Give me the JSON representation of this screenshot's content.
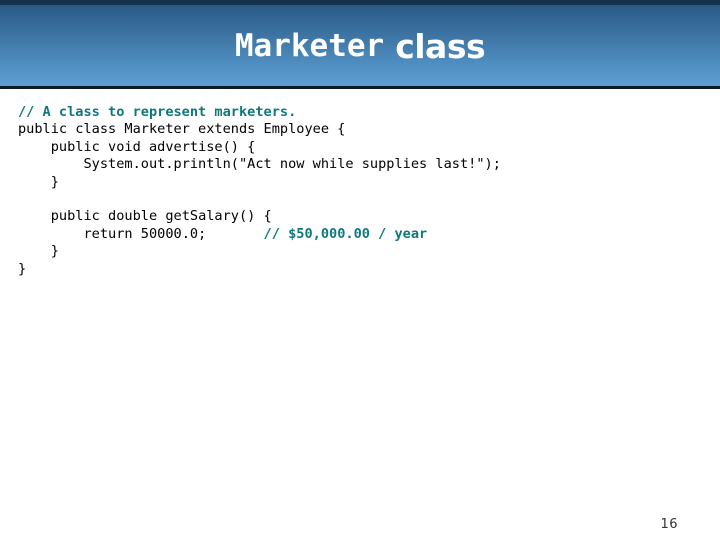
{
  "slide": {
    "title": {
      "mono_part": "Marketer",
      "sans_part": "class"
    },
    "page_number": "16",
    "colors": {
      "header_gradient_top": "#1f4b75",
      "header_gradient_bottom": "#5c9cd0",
      "header_border": "#0d1a28",
      "title_text": "#ffffff",
      "code_text": "#000000",
      "comment_text": "#0f787c",
      "page_number_text": "#333333",
      "background": "#ffffff"
    }
  },
  "code": {
    "language": "java",
    "lines": [
      {
        "indent": "",
        "segments": [
          {
            "kind": "comment",
            "text": "// A class to represent marketers."
          }
        ]
      },
      {
        "indent": "",
        "segments": [
          {
            "kind": "plain",
            "text": "public class Marketer extends Employee {"
          }
        ]
      },
      {
        "indent": "    ",
        "segments": [
          {
            "kind": "plain",
            "text": "public void advertise() {"
          }
        ]
      },
      {
        "indent": "        ",
        "segments": [
          {
            "kind": "plain",
            "text": "System.out.println(\"Act now while supplies last!\");"
          }
        ]
      },
      {
        "indent": "    ",
        "segments": [
          {
            "kind": "plain",
            "text": "}"
          }
        ]
      },
      {
        "indent": "",
        "segments": []
      },
      {
        "indent": "    ",
        "segments": [
          {
            "kind": "plain",
            "text": "public double getSalary() {"
          }
        ]
      },
      {
        "indent": "        ",
        "segments": [
          {
            "kind": "plain",
            "text": "return 50000.0;       "
          },
          {
            "kind": "comment",
            "text": "// $50,000.00 / year"
          }
        ]
      },
      {
        "indent": "    ",
        "segments": [
          {
            "kind": "plain",
            "text": "}"
          }
        ]
      },
      {
        "indent": "",
        "segments": [
          {
            "kind": "plain",
            "text": "}"
          }
        ]
      }
    ]
  }
}
